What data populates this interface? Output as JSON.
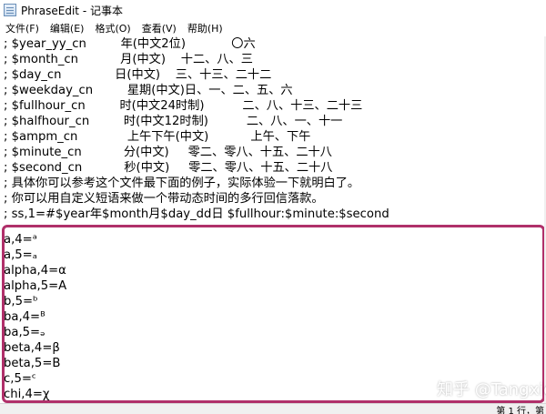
{
  "window": {
    "title": "PhraseEdit - 记事本"
  },
  "menu": [
    "文件(F)",
    "编辑(E)",
    "格式(O)",
    "查看(V)",
    "帮助(H)"
  ],
  "editor": {
    "lines": [
      "; $year_yy_cn         年(中文2位)            〇六",
      "; $month_cn           月(中文)    十二、八、三",
      "; $day_cn              日(中文)    三、十三、二十二",
      "; $weekday_cn         星期(中文)日、一、二、五、六",
      "; $fullhour_cn         时(中文24时制)          二、八、十三、二十三",
      "; $halfhour_cn         时(中文12时制)          二、八、一、十一",
      "; $ampm_cn             上午下午(中文)           上午、下午",
      "; $minute_cn           分(中文)     零二、零八、十五、二十八",
      "; $second_cn           秒(中文)     零二、零八、十五、二十八",
      "; 具体你可以参考这个文件最下面的例子，实际体验一下就明白了。",
      "; 你可以用自定义短语来做一个带动态时间的多行回信落款。",
      "; ss,1=#$year年$month月$day_dd日 $fullhour:$minute:$second",
      "",
      "a,4=ᵃ",
      "a,5=ₐ",
      "alpha,4=α",
      "alpha,5=A",
      "b,5=ᵇ",
      "ba,4=ᴮ",
      "ba,5=ₔ",
      "beta,4=β",
      "beta,5=B",
      "c,5=ᶜ",
      "chi,4=χ"
    ]
  },
  "status": {
    "position": "第 1 行，第"
  },
  "watermark": "知乎 @Tangxic"
}
